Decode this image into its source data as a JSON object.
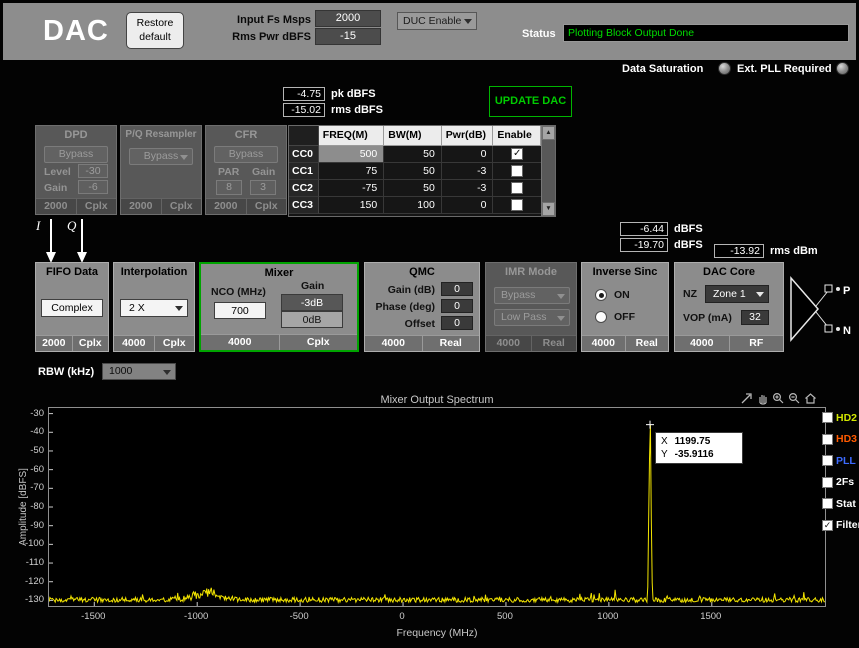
{
  "header": {
    "title": "DAC",
    "restore_button": "Restore default",
    "input_fs_label": "Input Fs Msps",
    "input_fs_value": "2000",
    "rms_pwr_label": "Rms Pwr dBFS",
    "rms_pwr_value": "-15",
    "duc_dropdown": "DUC Enable",
    "status_label": "Status",
    "status_value": "Plotting Block Output Done",
    "status_color": "#00dc00"
  },
  "indicators": {
    "data_saturation": "Data Saturation",
    "ext_pll": "Ext. PLL Required"
  },
  "update_section": {
    "pk_value": "-4.75",
    "pk_unit": "pk dBFS",
    "rms_value": "-15.02",
    "rms_unit": "rms dBFS",
    "update_button": "UPDATE DAC"
  },
  "blocks": {
    "dpd": {
      "title": "DPD",
      "bypass": "Bypass",
      "level_label": "Level",
      "level_value": "-30",
      "gain_label": "Gain",
      "gain_value": "-6",
      "rate": "2000",
      "format": "Cplx"
    },
    "resampler": {
      "title": "P/Q Resampler",
      "bypass": "Bypass",
      "rate": "2000",
      "format": "Cplx"
    },
    "cfr": {
      "title": "CFR",
      "bypass": "Bypass",
      "par_label": "PAR",
      "gain_label": "Gain",
      "par_value": "8",
      "gain_value": "3",
      "rate": "2000",
      "format": "Cplx"
    }
  },
  "cc_table": {
    "headers": [
      "",
      "FREQ(M)",
      "BW(M)",
      "Pwr(dB)",
      "Enable"
    ],
    "rows": [
      {
        "name": "CC0",
        "freq": "500",
        "bw": "50",
        "pwr": "0",
        "enabled": true
      },
      {
        "name": "CC1",
        "freq": "75",
        "bw": "50",
        "pwr": "-3",
        "enabled": false
      },
      {
        "name": "CC2",
        "freq": "-75",
        "bw": "50",
        "pwr": "-3",
        "enabled": false
      },
      {
        "name": "CC3",
        "freq": "150",
        "bw": "100",
        "pwr": "0",
        "enabled": false
      }
    ]
  },
  "iq": {
    "i": "I",
    "q": "Q"
  },
  "chain_readouts": {
    "pk_value": "-6.44",
    "pk_unit": "dBFS",
    "rms_value": "-19.70",
    "rms_unit": "dBFS",
    "power_value": "-13.92",
    "power_unit": "rms dBm"
  },
  "chain": {
    "fifo": {
      "title": "FIFO Data",
      "value": "Complex",
      "rate": "2000",
      "format": "Cplx"
    },
    "interpolation": {
      "title": "Interpolation",
      "value": "2 X",
      "rate": "4000",
      "format": "Cplx"
    },
    "mixer": {
      "title": "Mixer",
      "nco_label": "NCO (MHz)",
      "nco_value": "700",
      "gain_label": "Gain",
      "gain_options": [
        "-3dB",
        "0dB"
      ],
      "gain_selected_index": 0,
      "rate": "4000",
      "format": "Cplx"
    },
    "qmc": {
      "title": "QMC",
      "fields": [
        {
          "label": "Gain (dB)",
          "value": "0"
        },
        {
          "label": "Phase (deg)",
          "value": "0"
        },
        {
          "label": "Offset",
          "value": "0"
        }
      ],
      "rate": "4000",
      "format": "Real"
    },
    "imr": {
      "title": "IMR Mode",
      "option1": "Bypass",
      "option2": "Low Pass",
      "rate": "4000",
      "format": "Real"
    },
    "inverse_sinc": {
      "title": "Inverse Sinc",
      "on_label": "ON",
      "off_label": "OFF",
      "selected": "ON",
      "rate": "4000",
      "format": "Real"
    },
    "dac_core": {
      "title": "DAC Core",
      "nz_label": "NZ",
      "nz_value": "Zone 1",
      "vop_label": "VOP (mA)",
      "vop_value": "32",
      "rate": "4000",
      "format": "RF"
    }
  },
  "output_pins": {
    "p": "P",
    "n": "N"
  },
  "rbw": {
    "label": "RBW (kHz)",
    "value": "1000"
  },
  "chart_data": {
    "type": "line",
    "title": "Mixer Output Spectrum",
    "xlabel": "Frequency (MHz)",
    "ylabel": "Amplitude [dBFS]",
    "xlim": [
      -1720,
      2050
    ],
    "ylim": [
      -133,
      -27
    ],
    "xticks": [
      -1500,
      -1000,
      -500,
      0,
      500,
      1000,
      1500
    ],
    "yticks": [
      -30,
      -40,
      -50,
      -60,
      -70,
      -80,
      -90,
      -100,
      -110,
      -120,
      -130
    ],
    "grid": false,
    "legend_position": "right",
    "trace_color": "#f2e400",
    "noise_floor_dbfs": -131,
    "noise_bump": {
      "x": -950,
      "height_db": 6,
      "width": 60
    },
    "tone": {
      "x": 1199.75,
      "y": -35.9116
    },
    "cursor_readout": {
      "x_label": "X",
      "x_value": "1199.75",
      "y_label": "Y",
      "y_value": "-35.9116"
    },
    "legend": [
      {
        "label": "HD2",
        "color": "#d2e600",
        "checked": false
      },
      {
        "label": "HD3",
        "color": "#ff5a00",
        "checked": false
      },
      {
        "label": "PLL",
        "color": "#3d6bff",
        "checked": false
      },
      {
        "label": "2Fs",
        "color": "#ffffff",
        "checked": false
      },
      {
        "label": "Stat",
        "color": "#ffffff",
        "checked": false
      },
      {
        "label": "Filter",
        "color": "#ffffff",
        "checked": true
      }
    ],
    "toolbar_icons": [
      "cursor-tool",
      "pan-hand",
      "zoom-in",
      "zoom-out",
      "home"
    ]
  }
}
